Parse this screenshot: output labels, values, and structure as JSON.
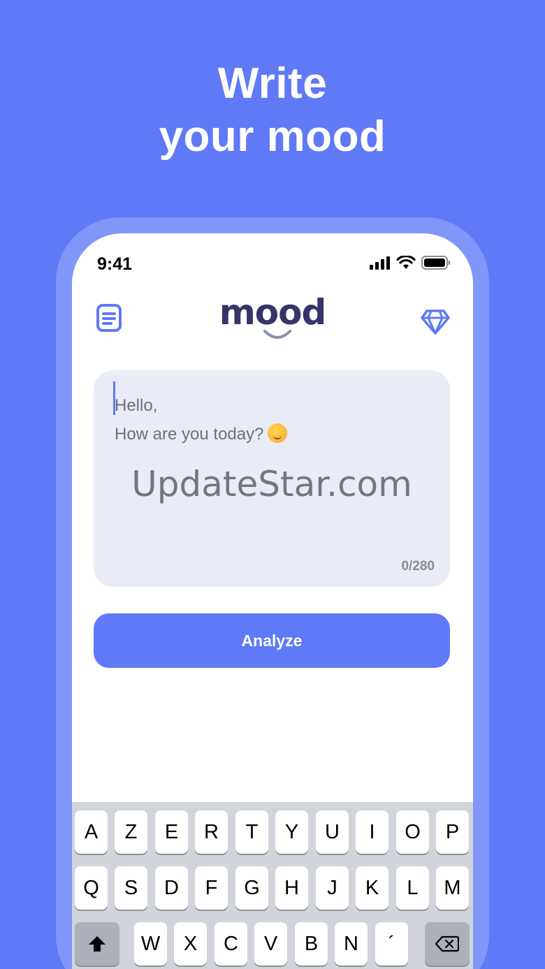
{
  "headline": {
    "line1": "Write",
    "line2": "your mood"
  },
  "status_bar": {
    "time": "9:41"
  },
  "app": {
    "logo_text": "mood",
    "text_card": {
      "greeting": "Hello,",
      "question": "How are you today?",
      "watermark": "UpdateStar.com",
      "counter": "0/280"
    },
    "analyze_label": "Analyze"
  },
  "keyboard": {
    "row1": [
      "A",
      "Z",
      "E",
      "R",
      "T",
      "Y",
      "U",
      "I",
      "O",
      "P"
    ],
    "row2": [
      "Q",
      "S",
      "D",
      "F",
      "G",
      "H",
      "J",
      "K",
      "L",
      "M"
    ],
    "row3": [
      "W",
      "X",
      "C",
      "V",
      "B",
      "N",
      "´"
    ]
  },
  "colors": {
    "accent": "#6079f6",
    "logo": "#35356a",
    "card": "#e9ebf7"
  }
}
